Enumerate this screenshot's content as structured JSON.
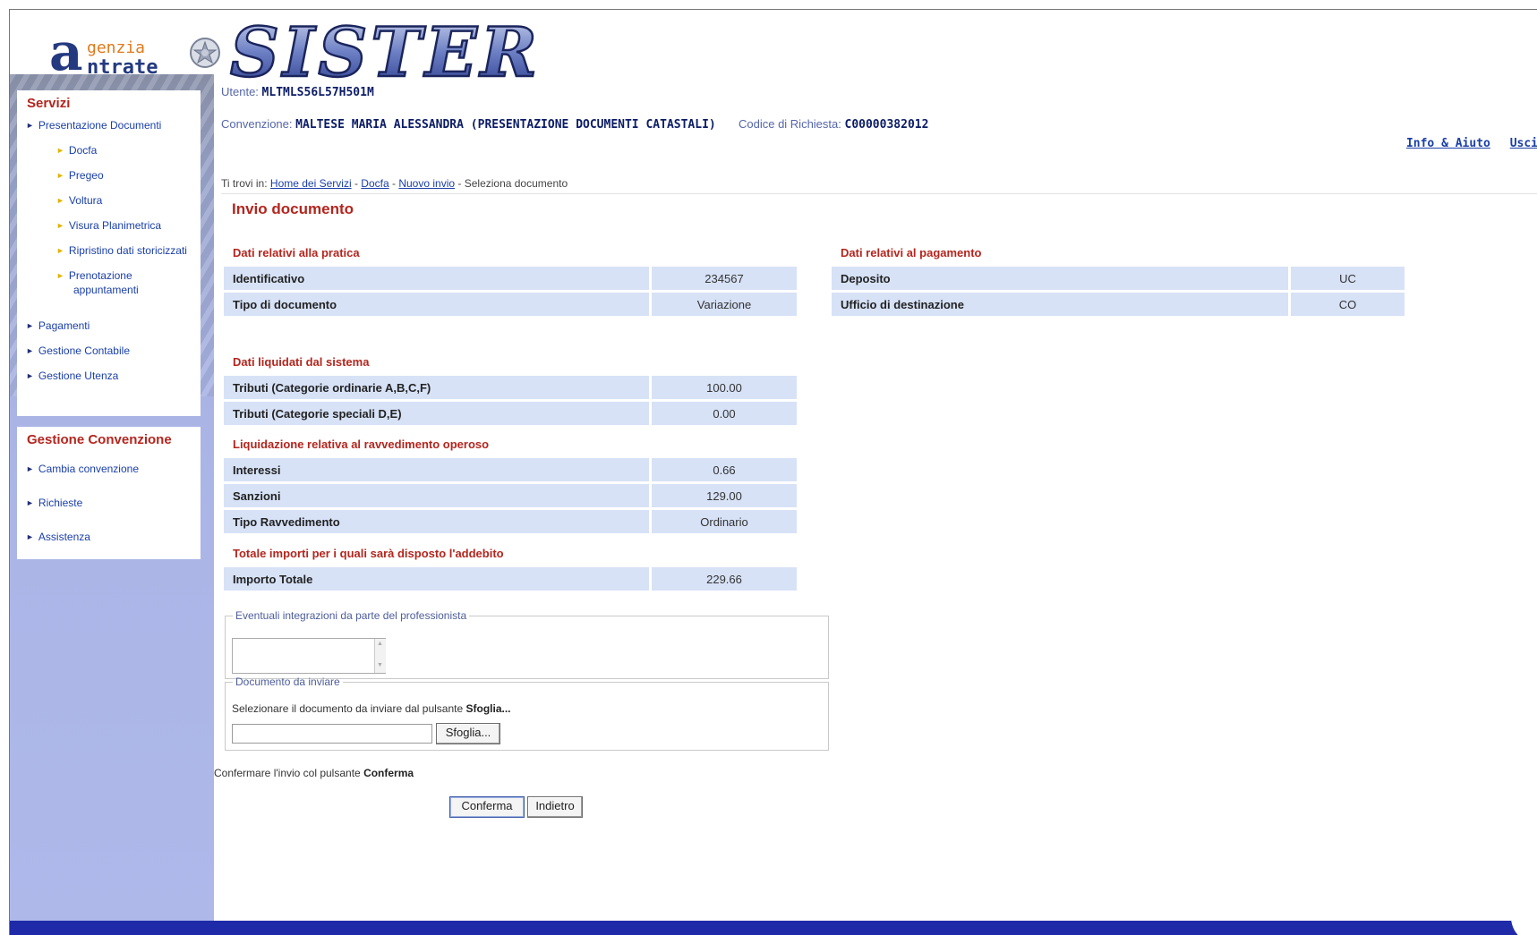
{
  "header": {
    "logo_genzia": "genzia",
    "logo_ntrate": "ntrate",
    "logo_a": "a",
    "brand": "SISTER"
  },
  "user": {
    "label": "Utente:",
    "value": "MLTMLS56L57H501M"
  },
  "convention": {
    "label": "Convenzione:",
    "value": "MALTESE MARIA ALESSANDRA (PRESENTAZIONE DOCUMENTI CATASTALI)",
    "request_label": "Codice di Richiesta:",
    "request_value": "C00000382012"
  },
  "top_links": {
    "info": "Info & Aiuto",
    "exit": "Usci"
  },
  "sidebar": {
    "servizi_title": "Servizi",
    "items": [
      {
        "label": "Presentazione Documenti"
      },
      {
        "label": "Docfa"
      },
      {
        "label": "Pregeo"
      },
      {
        "label": "Voltura"
      },
      {
        "label": "Visura Planimetrica"
      },
      {
        "label": "Ripristino dati storicizzati"
      },
      {
        "label": "Prenotazione"
      },
      {
        "label": "appuntamenti"
      },
      {
        "label": "Pagamenti"
      },
      {
        "label": "Gestione Contabile"
      },
      {
        "label": "Gestione Utenza"
      }
    ],
    "conv_title": "Gestione Convenzione",
    "conv_items": [
      {
        "label": "Cambia convenzione"
      },
      {
        "label": "Richieste"
      },
      {
        "label": "Assistenza"
      }
    ]
  },
  "breadcrumb": {
    "prefix": "Ti trovi in:",
    "home": "Home dei Servizi",
    "docfa": "Docfa",
    "nuovo": "Nuovo invio",
    "current": "- Seleziona documento",
    "dash": "-"
  },
  "page_title": "Invio documento",
  "pratica": {
    "title": "Dati relativi alla pratica",
    "rows": [
      {
        "key": "Identificativo",
        "value": "234567"
      },
      {
        "key": "Tipo di documento",
        "value": "Variazione"
      }
    ]
  },
  "pagamento": {
    "title": "Dati relativi al pagamento",
    "rows": [
      {
        "key": "Deposito",
        "value": "UC"
      },
      {
        "key": "Ufficio di destinazione",
        "value": "CO"
      }
    ]
  },
  "liquidati": {
    "title": "Dati liquidati dal sistema",
    "rows": [
      {
        "key": "Tributi (Categorie ordinarie A,B,C,F)",
        "value": "100.00"
      },
      {
        "key": "Tributi (Categorie speciali D,E)",
        "value": "0.00"
      }
    ]
  },
  "ravvedimento": {
    "title": "Liquidazione relativa al ravvedimento operoso",
    "rows": [
      {
        "key": "Interessi",
        "value": "0.66"
      },
      {
        "key": "Sanzioni",
        "value": "129.00"
      },
      {
        "key": "Tipo Ravvedimento",
        "value": "Ordinario"
      }
    ]
  },
  "totale": {
    "title": "Totale importi per i quali sarà disposto l'addebito",
    "rows": [
      {
        "key": "Importo Totale",
        "value": "229.66"
      }
    ]
  },
  "integrazioni": {
    "legend": "Eventuali integrazioni da parte del professionista",
    "value": ""
  },
  "documento": {
    "legend": "Documento da inviare",
    "hint": "Selezionare il documento da inviare dal pulsante",
    "hint_bold": "Sfoglia...",
    "browse": "Sfoglia..."
  },
  "confirm": {
    "text": "Confermare l'invio col pulsante",
    "bold": "Conferma"
  },
  "buttons": {
    "confirm": "Conferma",
    "back": "Indietro"
  },
  "colors": {
    "accent_red": "#b3261e",
    "link_blue": "#1a3fa8",
    "row_bg": "#d7e2f7",
    "footer": "#1f2aa8"
  }
}
